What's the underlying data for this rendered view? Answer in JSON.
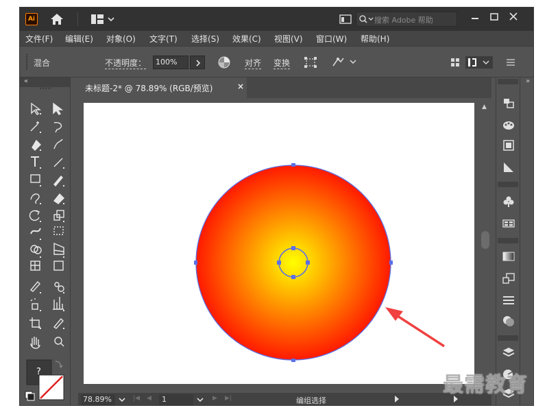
{
  "app": {
    "logo_text": "Ai",
    "search_placeholder": "搜索 Adobe 帮助"
  },
  "menu": {
    "items": [
      "文件(F)",
      "编辑(E)",
      "对象(O)",
      "文字(T)",
      "选择(S)",
      "效果(C)",
      "视图(V)",
      "窗口(W)",
      "帮助(H)"
    ]
  },
  "control_bar": {
    "blend_label": "混合",
    "opacity_label": "不透明度：",
    "opacity_value": "100%",
    "align_label": "对齐",
    "transform_label": "变换"
  },
  "document": {
    "tab_title": "未标题-2* @ 78.89% (RGB/预览)",
    "tab_close": "×"
  },
  "artwork": {
    "outer_circle": {
      "fill_center": "#ffff00",
      "fill_edge": "#ff1a00",
      "stroke": "#5b6fe6"
    },
    "inner_circle": {
      "stroke": "#5b6fe6"
    },
    "annotation_arrow_color": "#f04040"
  },
  "status_bar": {
    "zoom": "78.89%",
    "artboard": "1",
    "status": "编组选择"
  },
  "tool_panel": {
    "fill_stroke_question": "?"
  },
  "watermark": "最需教育",
  "colors": {
    "titlebar": "#323232",
    "panel": "#535353",
    "menubar": "#454545",
    "accent_orange": "#ff7c00"
  }
}
